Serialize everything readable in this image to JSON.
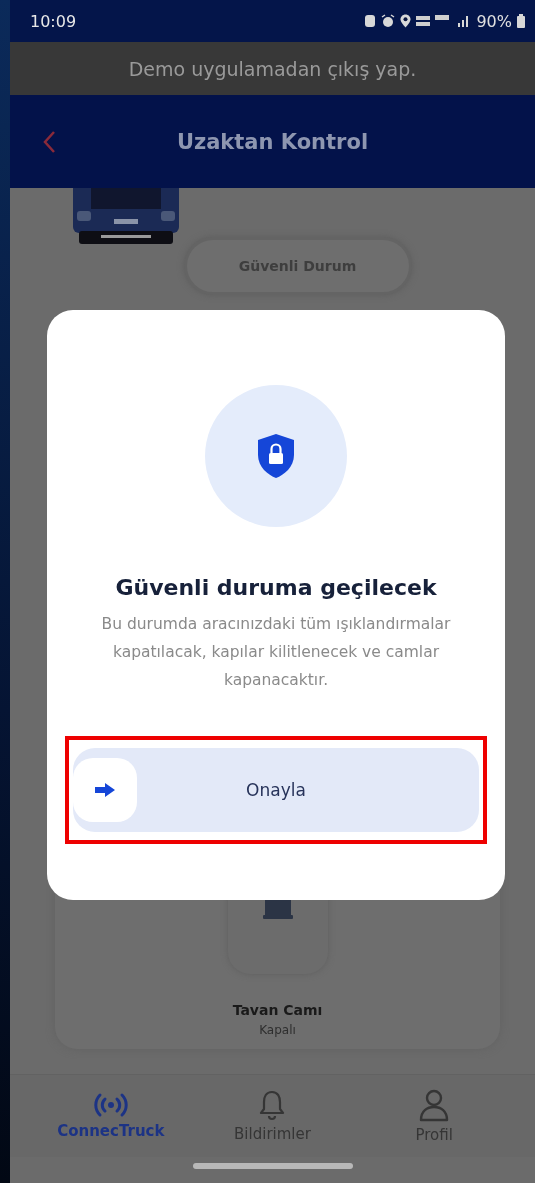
{
  "status_bar": {
    "time": "10:09",
    "battery": "90%"
  },
  "demo_banner": "Demo uygulamadan çıkış yap.",
  "header": {
    "title": "Uzaktan Kontrol"
  },
  "background": {
    "mode_button": "Güvenli Durum",
    "card": {
      "title": "Tavan Camı",
      "status": "Kapalı"
    }
  },
  "dialog": {
    "title": "Güvenli duruma geçilecek",
    "message": "Bu durumda aracınızdaki tüm ışıklandırmalar kapatılacak, kapılar kilitlenecek ve camlar kapanacaktır.",
    "confirm": {
      "label": "Onayla",
      "highlighted": true
    }
  },
  "tabs": [
    {
      "label": "ConnecTruck",
      "kind": "broadcast",
      "selected": true
    },
    {
      "label": "Bildirimler",
      "kind": "bell",
      "selected": false
    },
    {
      "label": "Profil",
      "kind": "person",
      "selected": false
    }
  ]
}
